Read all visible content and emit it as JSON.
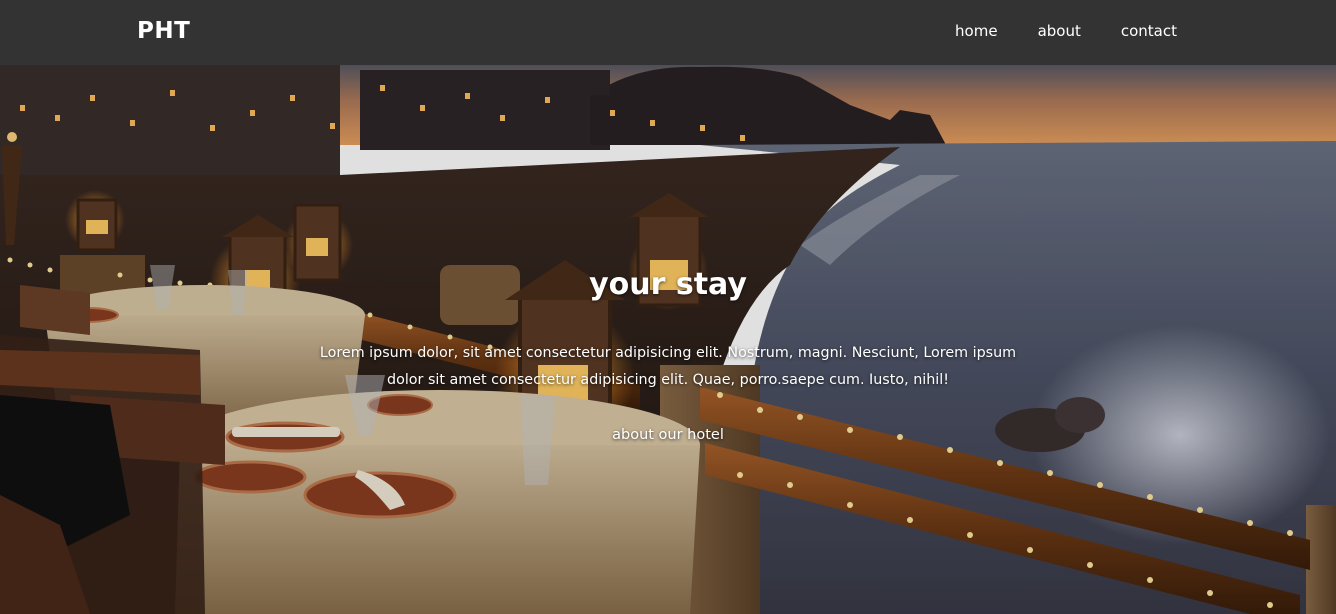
{
  "navbar": {
    "brand": "PHT",
    "links": [
      {
        "label": "home"
      },
      {
        "label": "about"
      },
      {
        "label": "contact"
      }
    ],
    "background": "#333333"
  },
  "hero": {
    "title": "your stay",
    "description": "Lorem ipsum dolor, sit amet consectetur adipisicing elit. Nostrum, magni. Nesciunt, Lorem ipsum dolor sit amet consectetur adipisicing elit. Quae, porro.saepe cum. Iusto, nihil!",
    "link_label": "about our hotel",
    "background_image": "seaside restaurant terrace at dusk with lanterns and string lights"
  }
}
